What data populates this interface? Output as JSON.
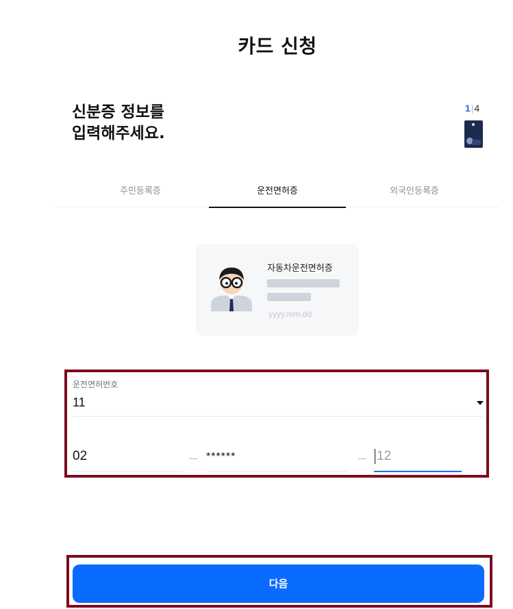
{
  "header": {
    "title": "카드 신청"
  },
  "intro": {
    "heading_line1": "신분증 정보를",
    "heading_line2": "입력해주세요."
  },
  "progress": {
    "current": "1",
    "separator": "|",
    "total": "4"
  },
  "tabs": [
    {
      "label": "주민등록증",
      "selected": false
    },
    {
      "label": "운전면허증",
      "selected": true
    },
    {
      "label": "외국인등록증",
      "selected": false
    }
  ],
  "license_preview": {
    "title": "자동차운전면허증",
    "date_placeholder": "yyyy.mm.dd"
  },
  "form": {
    "label": "운전면허번호",
    "region_value": "11",
    "segment1_value": "02",
    "segment2_value": "******",
    "segment3_placeholder": "12"
  },
  "footer": {
    "next_label": "다음"
  },
  "colors": {
    "accent": "#0a6bff",
    "highlight_border": "#7c0b1f",
    "card": "#1c2a4d"
  }
}
